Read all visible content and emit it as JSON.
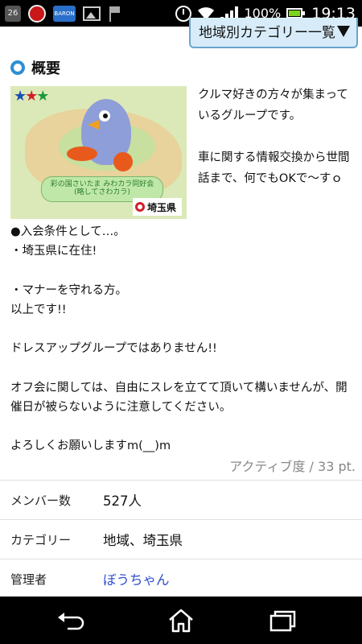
{
  "status_bar": {
    "notification_badge": "26",
    "app_label": "BARON",
    "battery_percent": "100%",
    "time": "19:13"
  },
  "region_button": {
    "label": "地域別カテゴリー一覧"
  },
  "overview": {
    "title": "概要",
    "side_text": "クルマ好きの方々が集まっているグループです。\n\n車に関する情報交換から世間話まで、何でもOKで〜すｏ",
    "image": {
      "banner": "彩の国さいたま みわカラ同好会\n(略してさわカラ)",
      "pref_name": "埼玉県"
    },
    "body_text": "●入会条件として…。\n・埼玉県に在住!\n\n・マナーを守れる方。\n以上です!!\n\nドレスアップグループではありません!!\n\nオフ会に関しては、自由にスレを立てて頂いて構いませんが、開催日が被らないように注意してください。\n\nよろしくお願いしますm(__)m"
  },
  "activity": {
    "label": "アクティブ度 / 33 pt."
  },
  "info": {
    "members_label": "メンバー数",
    "members_value": "527人",
    "category_label": "カテゴリー",
    "category_value": "地域、埼玉県",
    "admin_label": "管理者",
    "admin_value": "ぼうちゃん"
  },
  "colors": {
    "accent_blue": "#2e8fd3",
    "link_blue": "#2e4fd0",
    "button_bg": "#d7ecf8"
  }
}
